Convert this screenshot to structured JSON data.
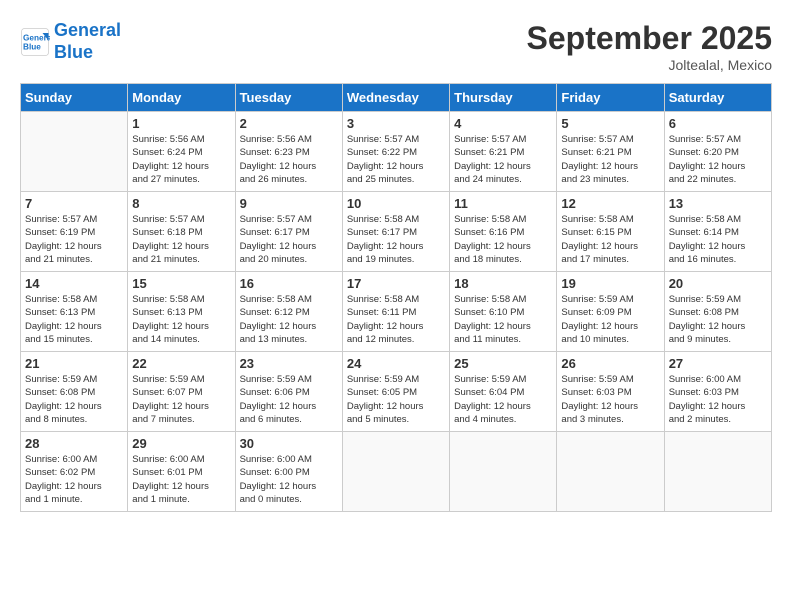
{
  "header": {
    "logo_line1": "General",
    "logo_line2": "Blue",
    "month": "September 2025",
    "location": "Joltealal, Mexico"
  },
  "weekdays": [
    "Sunday",
    "Monday",
    "Tuesday",
    "Wednesday",
    "Thursday",
    "Friday",
    "Saturday"
  ],
  "weeks": [
    [
      {
        "day": "",
        "info": ""
      },
      {
        "day": "1",
        "info": "Sunrise: 5:56 AM\nSunset: 6:24 PM\nDaylight: 12 hours\nand 27 minutes."
      },
      {
        "day": "2",
        "info": "Sunrise: 5:56 AM\nSunset: 6:23 PM\nDaylight: 12 hours\nand 26 minutes."
      },
      {
        "day": "3",
        "info": "Sunrise: 5:57 AM\nSunset: 6:22 PM\nDaylight: 12 hours\nand 25 minutes."
      },
      {
        "day": "4",
        "info": "Sunrise: 5:57 AM\nSunset: 6:21 PM\nDaylight: 12 hours\nand 24 minutes."
      },
      {
        "day": "5",
        "info": "Sunrise: 5:57 AM\nSunset: 6:21 PM\nDaylight: 12 hours\nand 23 minutes."
      },
      {
        "day": "6",
        "info": "Sunrise: 5:57 AM\nSunset: 6:20 PM\nDaylight: 12 hours\nand 22 minutes."
      }
    ],
    [
      {
        "day": "7",
        "info": "Sunrise: 5:57 AM\nSunset: 6:19 PM\nDaylight: 12 hours\nand 21 minutes."
      },
      {
        "day": "8",
        "info": "Sunrise: 5:57 AM\nSunset: 6:18 PM\nDaylight: 12 hours\nand 21 minutes."
      },
      {
        "day": "9",
        "info": "Sunrise: 5:57 AM\nSunset: 6:17 PM\nDaylight: 12 hours\nand 20 minutes."
      },
      {
        "day": "10",
        "info": "Sunrise: 5:58 AM\nSunset: 6:17 PM\nDaylight: 12 hours\nand 19 minutes."
      },
      {
        "day": "11",
        "info": "Sunrise: 5:58 AM\nSunset: 6:16 PM\nDaylight: 12 hours\nand 18 minutes."
      },
      {
        "day": "12",
        "info": "Sunrise: 5:58 AM\nSunset: 6:15 PM\nDaylight: 12 hours\nand 17 minutes."
      },
      {
        "day": "13",
        "info": "Sunrise: 5:58 AM\nSunset: 6:14 PM\nDaylight: 12 hours\nand 16 minutes."
      }
    ],
    [
      {
        "day": "14",
        "info": "Sunrise: 5:58 AM\nSunset: 6:13 PM\nDaylight: 12 hours\nand 15 minutes."
      },
      {
        "day": "15",
        "info": "Sunrise: 5:58 AM\nSunset: 6:13 PM\nDaylight: 12 hours\nand 14 minutes."
      },
      {
        "day": "16",
        "info": "Sunrise: 5:58 AM\nSunset: 6:12 PM\nDaylight: 12 hours\nand 13 minutes."
      },
      {
        "day": "17",
        "info": "Sunrise: 5:58 AM\nSunset: 6:11 PM\nDaylight: 12 hours\nand 12 minutes."
      },
      {
        "day": "18",
        "info": "Sunrise: 5:58 AM\nSunset: 6:10 PM\nDaylight: 12 hours\nand 11 minutes."
      },
      {
        "day": "19",
        "info": "Sunrise: 5:59 AM\nSunset: 6:09 PM\nDaylight: 12 hours\nand 10 minutes."
      },
      {
        "day": "20",
        "info": "Sunrise: 5:59 AM\nSunset: 6:08 PM\nDaylight: 12 hours\nand 9 minutes."
      }
    ],
    [
      {
        "day": "21",
        "info": "Sunrise: 5:59 AM\nSunset: 6:08 PM\nDaylight: 12 hours\nand 8 minutes."
      },
      {
        "day": "22",
        "info": "Sunrise: 5:59 AM\nSunset: 6:07 PM\nDaylight: 12 hours\nand 7 minutes."
      },
      {
        "day": "23",
        "info": "Sunrise: 5:59 AM\nSunset: 6:06 PM\nDaylight: 12 hours\nand 6 minutes."
      },
      {
        "day": "24",
        "info": "Sunrise: 5:59 AM\nSunset: 6:05 PM\nDaylight: 12 hours\nand 5 minutes."
      },
      {
        "day": "25",
        "info": "Sunrise: 5:59 AM\nSunset: 6:04 PM\nDaylight: 12 hours\nand 4 minutes."
      },
      {
        "day": "26",
        "info": "Sunrise: 5:59 AM\nSunset: 6:03 PM\nDaylight: 12 hours\nand 3 minutes."
      },
      {
        "day": "27",
        "info": "Sunrise: 6:00 AM\nSunset: 6:03 PM\nDaylight: 12 hours\nand 2 minutes."
      }
    ],
    [
      {
        "day": "28",
        "info": "Sunrise: 6:00 AM\nSunset: 6:02 PM\nDaylight: 12 hours\nand 1 minute."
      },
      {
        "day": "29",
        "info": "Sunrise: 6:00 AM\nSunset: 6:01 PM\nDaylight: 12 hours\nand 1 minute."
      },
      {
        "day": "30",
        "info": "Sunrise: 6:00 AM\nSunset: 6:00 PM\nDaylight: 12 hours\nand 0 minutes."
      },
      {
        "day": "",
        "info": ""
      },
      {
        "day": "",
        "info": ""
      },
      {
        "day": "",
        "info": ""
      },
      {
        "day": "",
        "info": ""
      }
    ]
  ]
}
